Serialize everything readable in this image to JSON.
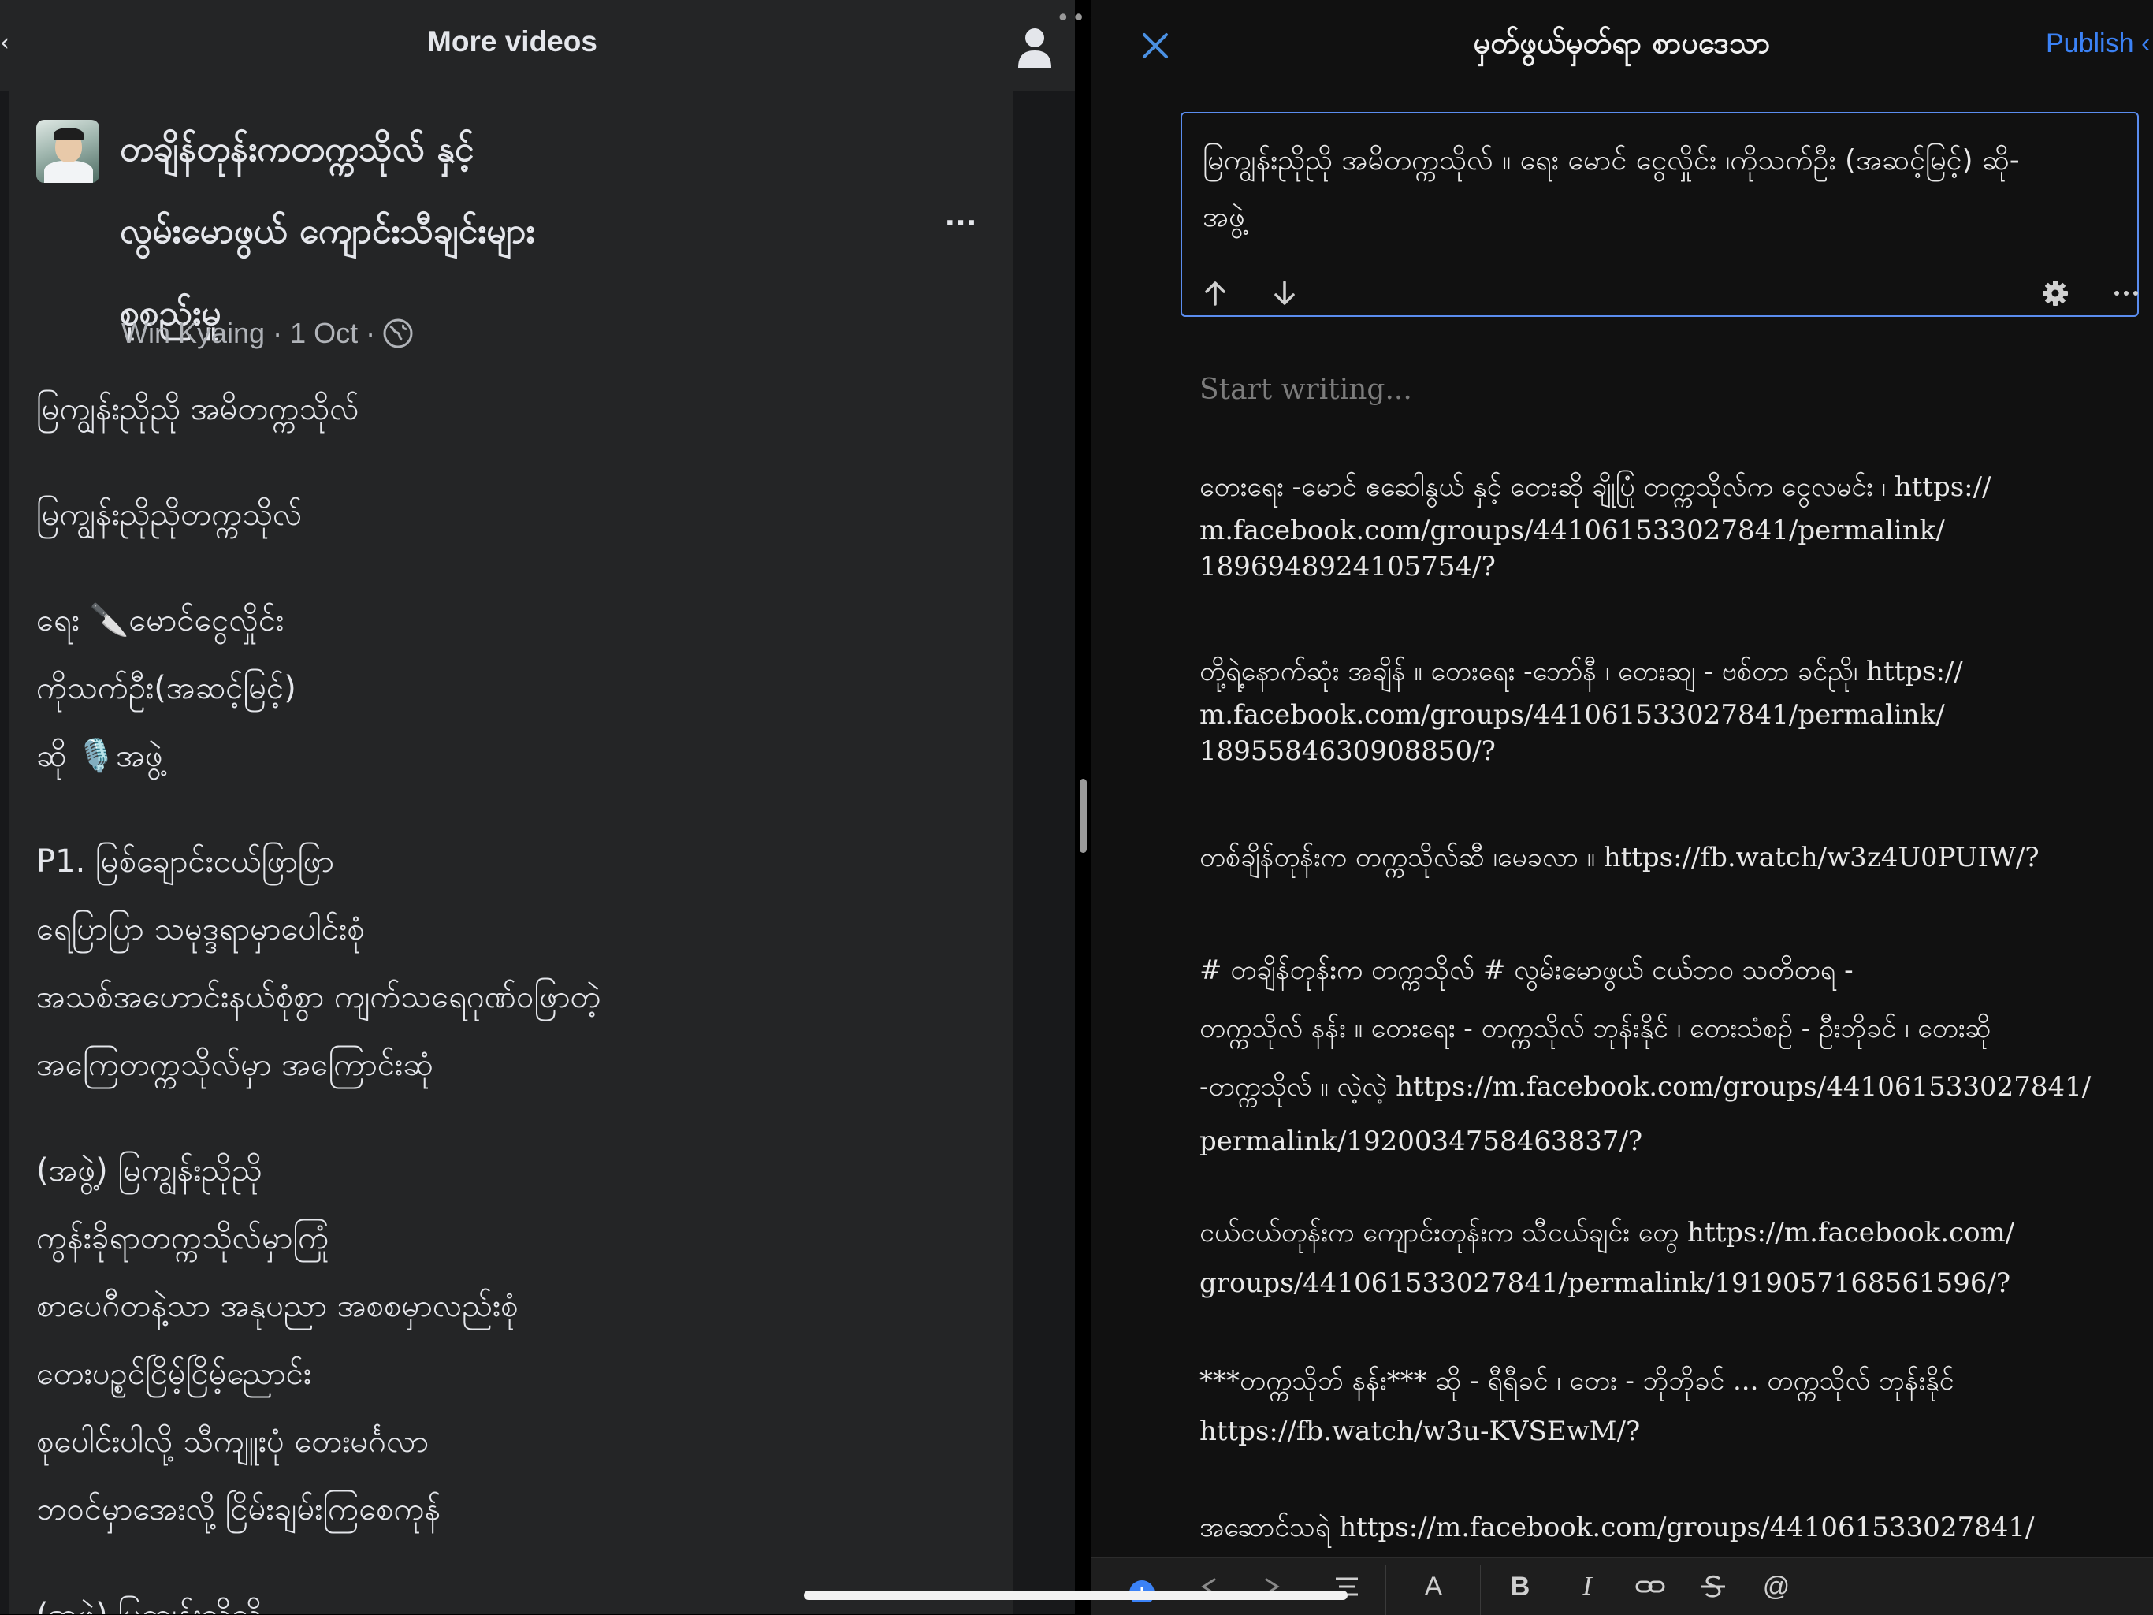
{
  "left_pane": {
    "header_title": "More videos",
    "post": {
      "title_lines": [
        "တချိန်တုန်းကတက္ကသိုလ် နှင့်",
        "လွမ်းမောဖွယ် ကျောင်းသီချင်းများ",
        "စုစည်းမှု"
      ],
      "author": "Win Kyaing",
      "date": "1 Oct",
      "separator": "·",
      "body_lines": [
        "မြကျွန်းညိုညို အမိတက္ကသိုလ်",
        "",
        "မြကျွန်းညိုညိုတက္ကသိုလ်",
        "",
        "ရေး 🔪မောင်ငွေလှိုင်း",
        "ကိုသက်ဦး(အဆင့်မြင့်)",
        "ဆို 🎙️အဖွဲ့",
        "",
        "P1. မြစ်ချောင်းငယ်ဖြာဖြာ",
        "ရေပြာပြာ သမုဒ္ဒရာမှာပေါင်းစုံ",
        "အသစ်အဟောင်းနယ်စုံစွာ ကျက်သရေဂုဏ်ဝဖြာတဲ့",
        "အကြေတက္ကသိုလ်မှာ အကြောင်းဆုံ",
        "",
        "(အဖွဲ့) မြကျွန်းညိုညို",
        "ကွန်းခိုရာတက္ကသိုလ်မှာကြုံ",
        "စာပေဂီတနဲ့သာ အနုပညာ အစစမှာလည်းစုံ",
        "တေးပဥ္စင်ငြိမ့်ငြိမ့်ညောင်း",
        "စုပေါင်းပါလို့ သီကျူးပုံ တေးမင်္ဂလာ",
        "ဘဝင်မှာအေးလို့ ငြိမ်းချမ်းကြစေကုန်",
        "",
        "(အဖွဲ့) မြကျွန်းညိုညို"
      ]
    }
  },
  "editor": {
    "title": "မှတ်ဖွယ်မှတ်ရာ စာပဒေသာ",
    "publish_label": "Publish",
    "selected_block_lines": [
      "မြကျွန်းညိုညို အမိတက္ကသိုလ် ။ ရေး မောင် ငွေလှိုင်း ၊ကိုသက်ဦး (အဆင့်မြင့်)  ဆို-",
      "အဖွဲ့"
    ],
    "placeholder": "Start writing...",
    "paragraphs": [
      [
        "တေးရေး -မောင် ဧဆေါနွယ် နှင့် တေးဆို ချိုပြုံ တက္ကသိုလ်က ငွေလမင်း ၊  https://",
        "m.facebook.com/groups/441061533027841/permalink/",
        "1896948924105754/?"
      ],
      [
        "တို့ရဲ့နောက်ဆုံး အချိန် ။  တေးရေး -ဘော်နီ ၊ တေးဆျ - ဗစ်တာ ခင်ညို၊   https://",
        "m.facebook.com/groups/441061533027841/permalink/",
        "1895584630908850/?"
      ],
      [
        "တစ်ချိန်တုန်းက တက္ကသိုလ်ဆီ ၊မေခလာ ။  https://fb.watch/w3z4U0PUIW/?"
      ],
      [
        "# တချိန်တုန်းက တက္ကသိုလ် # လွမ်းမောဖွယ် ငယ်ဘဝ သတိတရ  -",
        "တက္ကသိုလ် နန်း ။ တေးရေး - တက္ကသိုလ် ဘုန်းနိုင် ၊ တေးသံစဉ် - ဦးဘိုခင် ၊ တေးဆို",
        "-တက္ကသိုလ် ။ လဲ့လဲ့   https://m.facebook.com/groups/441061533027841/",
        "permalink/1920034758463837/?"
      ],
      [
        "ငယ်ငယ်တုန်းက ကျောင်းတုန်းက သီငယ်ချင်း တွေ  https://m.facebook.com/",
        "groups/441061533027841/permalink/1919057168561596/?"
      ],
      [
        "***တက္ကသိုဘ် နန်း*** ဆို - ရီရီခင် ၊ တေး - ဘိုဘိုခင် ... တက္ကသိုလ် ဘုန်းနိုင်",
        "https://fb.watch/w3u-KVSEwM/?"
      ],
      [
        "အဆောင်သရဲ  https://m.facebook.com/groups/441061533027841/"
      ]
    ],
    "toolbar": {
      "font_label": "A",
      "bold_label": "B",
      "italic_label": "I",
      "mention_label": "@"
    }
  },
  "colors": {
    "accent": "#3b82f6",
    "selection_border": "#5b8def",
    "left_background": "#242526",
    "right_background": "#111111"
  }
}
